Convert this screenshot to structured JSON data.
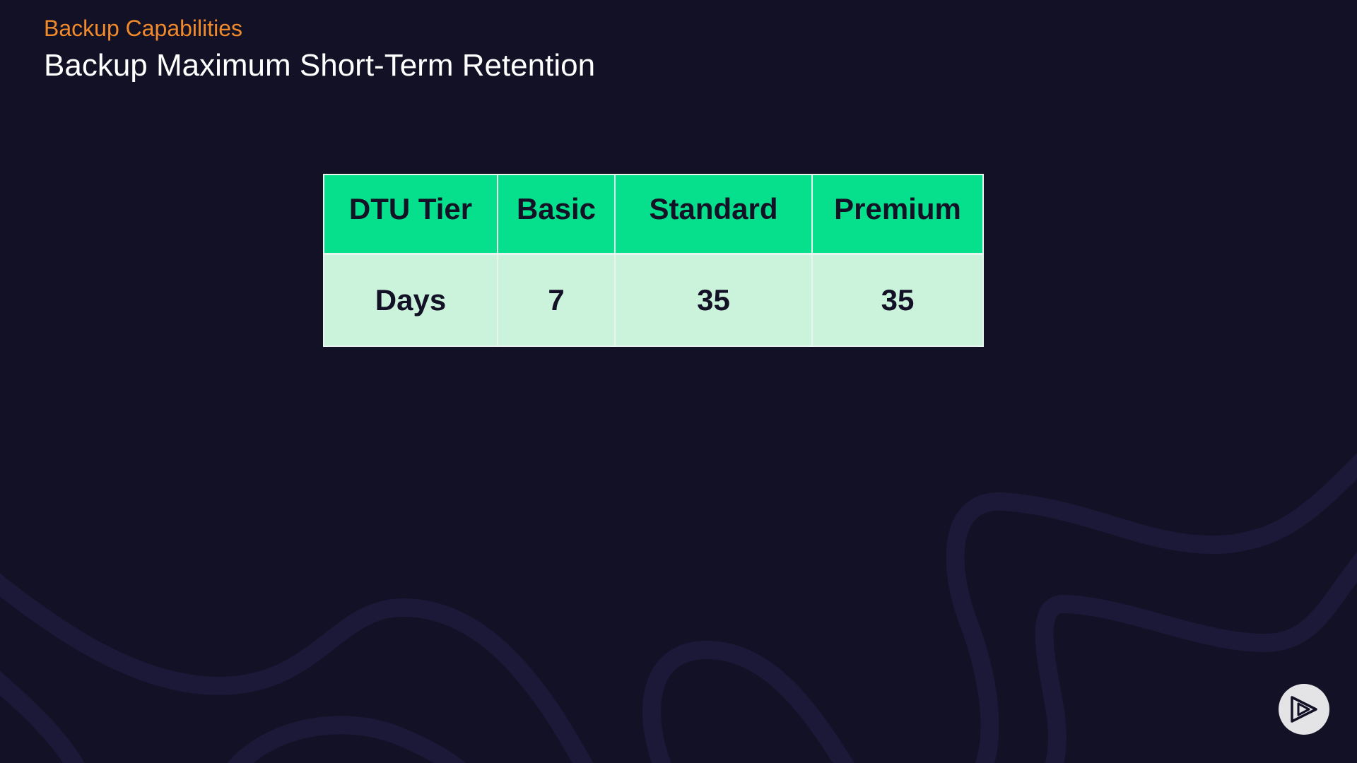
{
  "slide": {
    "subtitle": "Backup Capabilities",
    "title": "Backup Maximum Short-Term Retention"
  },
  "table": {
    "headers": [
      "DTU Tier",
      "Basic",
      "Standard",
      "Premium"
    ],
    "rows": [
      [
        "Days",
        "7",
        "35",
        "35"
      ]
    ]
  },
  "colors": {
    "background": "#131125",
    "subtitle": "#f18a2a",
    "title": "#ffffff",
    "header_fill": "#06df8c",
    "row_fill": "#cbf2da",
    "wave": "#1b1838"
  },
  "icons": {
    "play_button": "play-icon"
  }
}
